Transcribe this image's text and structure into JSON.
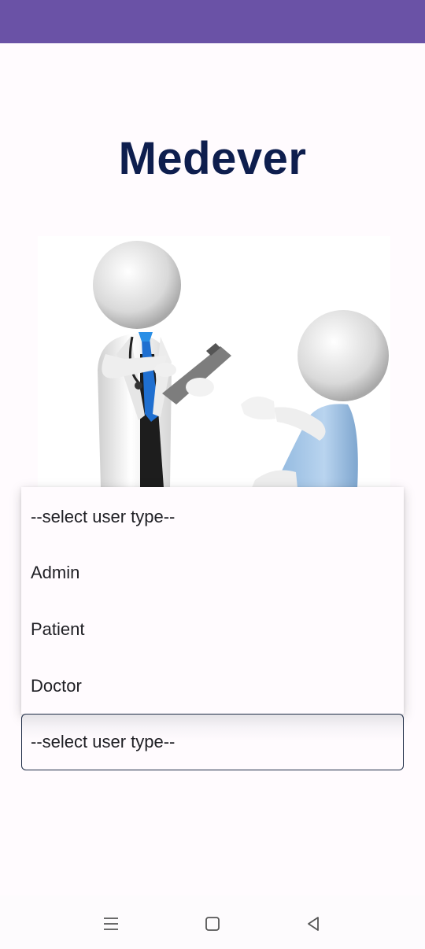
{
  "app": {
    "title": "Medever"
  },
  "illustration": {
    "subject": "doctor-with-clipboard-and-patient"
  },
  "dropdown": {
    "options": [
      "--select user type--",
      "Admin",
      "Patient",
      "Doctor"
    ],
    "selected": "--select user type--"
  },
  "navigation": {
    "icons": [
      "menu-icon",
      "home-icon",
      "back-icon"
    ]
  },
  "colors": {
    "status_bar": "#6a52a6",
    "title": "#0e1e4e",
    "background": "#fffbfe",
    "field_border": "#1d2b45"
  }
}
